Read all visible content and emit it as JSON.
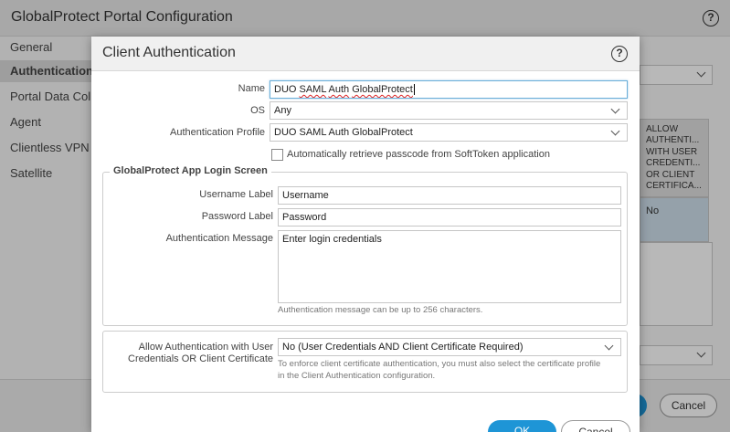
{
  "background_window": {
    "title": "GlobalProtect Portal Configuration",
    "help": "?",
    "nav": [
      {
        "label": "General"
      },
      {
        "label": "Authentication"
      },
      {
        "label": "Portal Data Coll"
      },
      {
        "label": "Agent"
      },
      {
        "label": "Clientless VPN"
      },
      {
        "label": "Satellite"
      }
    ],
    "table_header": "ALLOW AUTHENTI... WITH USER CREDENTI... OR CLIENT CERTIFICA...",
    "table_cell": "No",
    "cancel_label": "Cancel"
  },
  "dialog": {
    "title": "Client Authentication",
    "help": "?",
    "name": {
      "label": "Name",
      "value_parts": [
        "DUO ",
        "SAML",
        " ",
        "Auth",
        " ",
        "GlobalProtect"
      ]
    },
    "os": {
      "label": "OS",
      "value": "Any"
    },
    "auth_profile": {
      "label": "Authentication Profile",
      "value": "DUO SAML Auth GlobalProtect"
    },
    "auto_retrieve": {
      "label": "Automatically retrieve passcode from SoftToken application",
      "checked": false
    },
    "login_screen": {
      "title": "GlobalProtect App Login Screen",
      "username": {
        "label": "Username Label",
        "value": "Username"
      },
      "password": {
        "label": "Password Label",
        "value": "Password"
      },
      "message": {
        "label": "Authentication Message",
        "value": "Enter login credentials",
        "hint": "Authentication message can be up to 256 characters."
      }
    },
    "allow_auth": {
      "label_line1": "Allow Authentication with User",
      "label_line2": "Credentials OR Client Certificate",
      "value": "No (User Credentials AND Client Certificate Required)",
      "hint_line1": "To enforce client certificate authentication, you must also select the certificate profile",
      "hint_line2": "in the Client Authentication configuration."
    },
    "ok_label": "OK",
    "cancel_label": "Cancel"
  }
}
